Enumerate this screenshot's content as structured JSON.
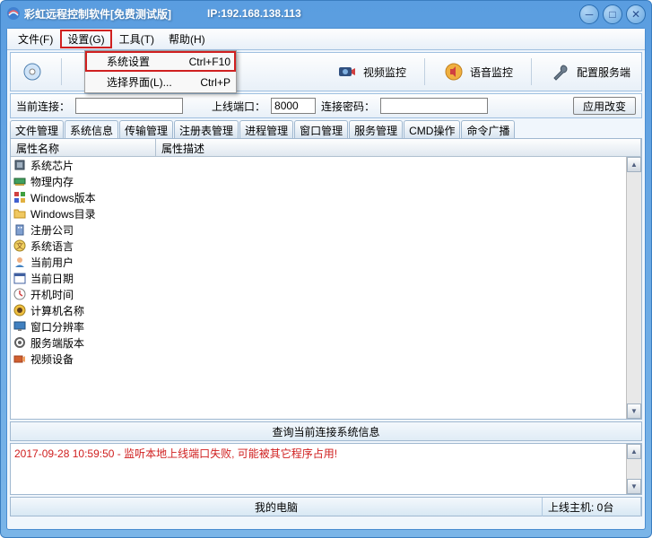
{
  "titlebar": {
    "title": "彩虹远程控制软件[免费测试版]",
    "ip_label": "IP:192.168.138.113"
  },
  "menubar": {
    "file": "文件(F)",
    "settings": "设置(G)",
    "tools": "工具(T)",
    "help": "帮助(H)"
  },
  "settings_menu": {
    "sys_settings": "系统设置",
    "sys_settings_sc": "Ctrl+F10",
    "select_ui": "选择界面(L)...",
    "select_ui_sc": "Ctrl+P"
  },
  "toolbar": {
    "video": "视频监控",
    "voice": "语音监控",
    "config_server": "配置服务端"
  },
  "conn": {
    "current_label": "当前连接：",
    "current_value": "",
    "port_label": "上线端口：",
    "port_value": "8000",
    "pwd_label": "连接密码：",
    "pwd_value": "",
    "apply": "应用改变"
  },
  "tabs": [
    "文件管理",
    "系统信息",
    "传输管理",
    "注册表管理",
    "进程管理",
    "窗口管理",
    "服务管理",
    "CMD操作",
    "命令广播"
  ],
  "list": {
    "col1": "属性名称",
    "col2": "属性描述",
    "rows": [
      {
        "icon": "chip",
        "label": "系统芯片"
      },
      {
        "icon": "ram",
        "label": "物理内存"
      },
      {
        "icon": "win",
        "label": "Windows版本"
      },
      {
        "icon": "folder",
        "label": "Windows目录"
      },
      {
        "icon": "company",
        "label": "注册公司"
      },
      {
        "icon": "lang",
        "label": "系统语言"
      },
      {
        "icon": "user",
        "label": "当前用户"
      },
      {
        "icon": "date",
        "label": "当前日期"
      },
      {
        "icon": "boot",
        "label": "开机时间"
      },
      {
        "icon": "pc",
        "label": "计算机名称"
      },
      {
        "icon": "screen",
        "label": "窗口分辨率"
      },
      {
        "icon": "service",
        "label": "服务端版本"
      },
      {
        "icon": "video",
        "label": "视频设备"
      }
    ]
  },
  "infobar": "查询当前连接系统信息",
  "log": "2017-09-28 10:59:50 - 监听本地上线端口失败, 可能被其它程序占用!",
  "statusbar": {
    "left": "我的电脑",
    "right": "上线主机: 0台"
  }
}
